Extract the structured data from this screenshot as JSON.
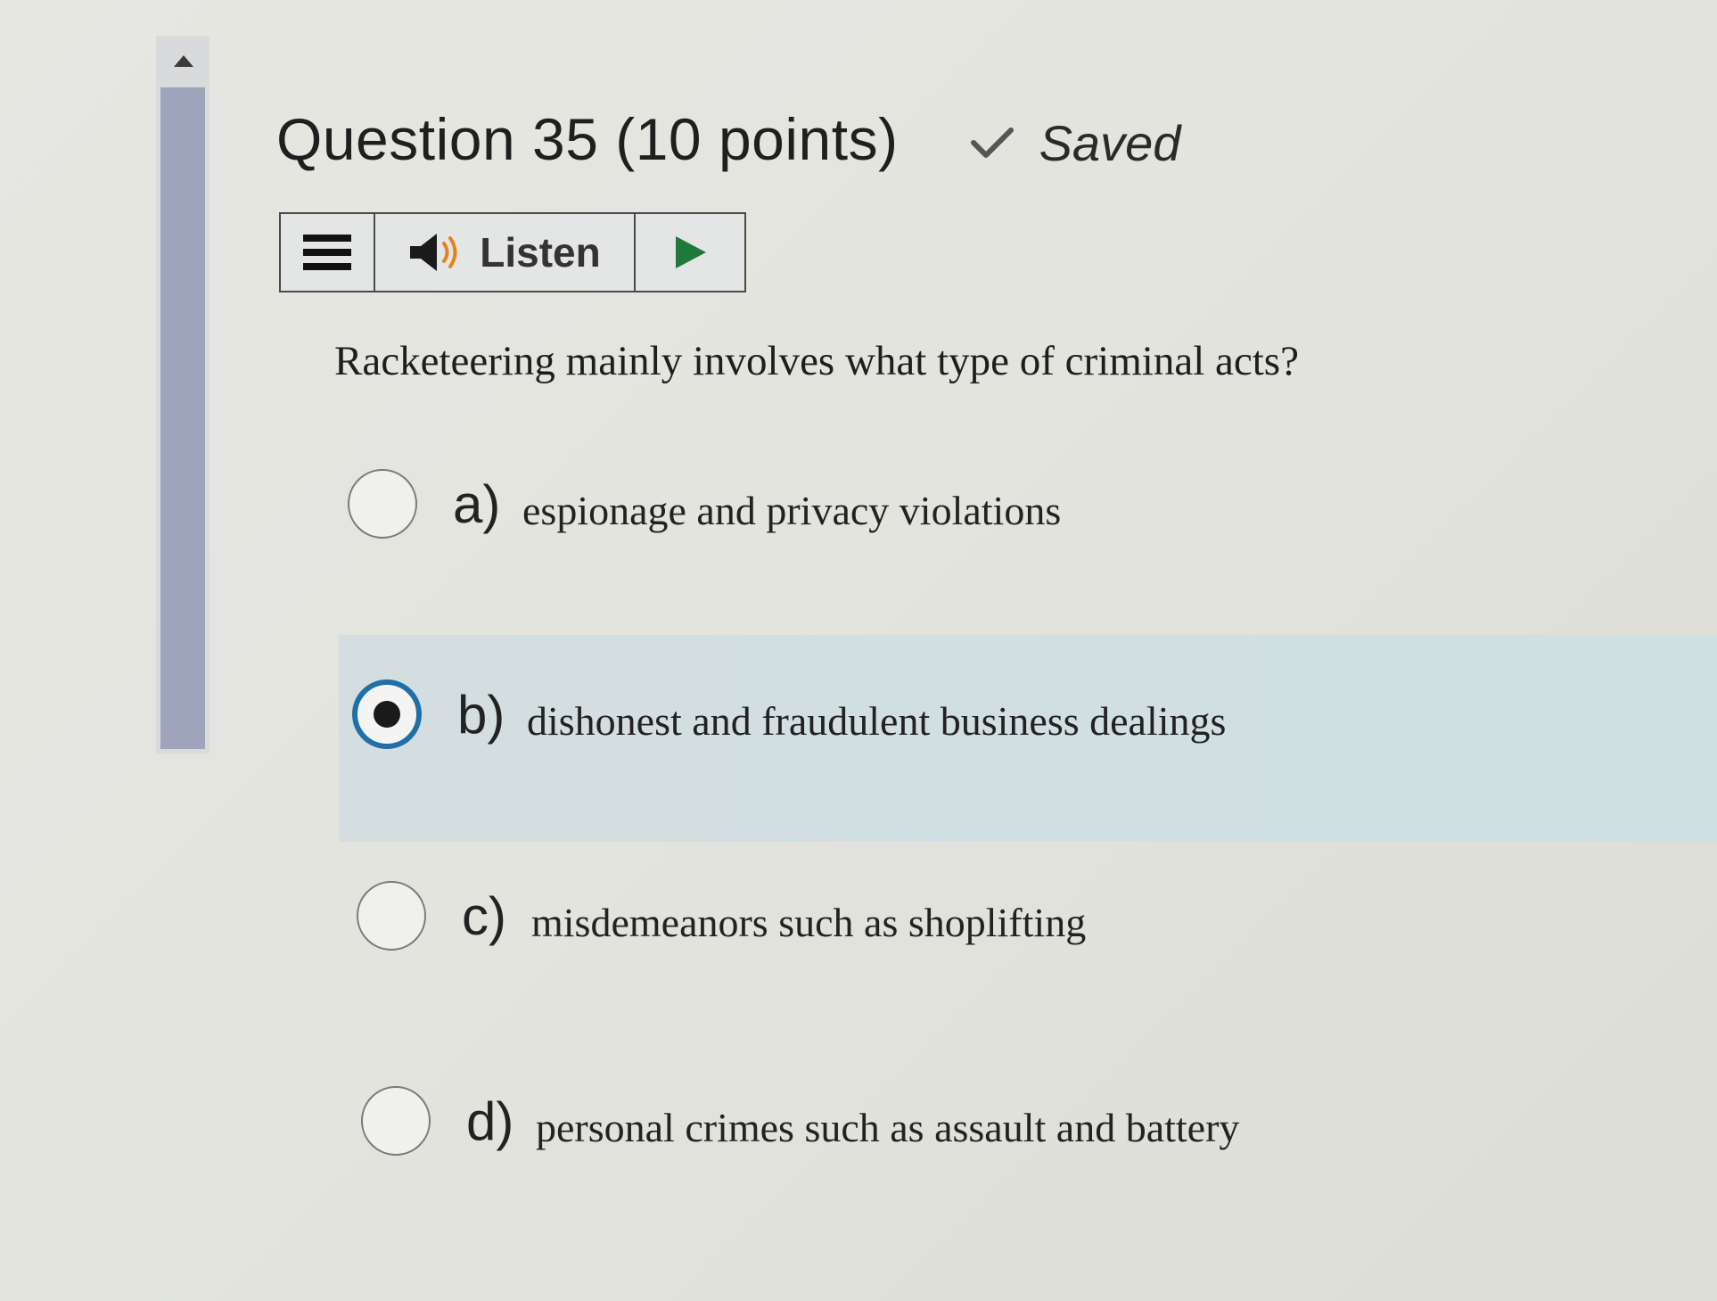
{
  "question": {
    "title": "Question 35 (10 points)",
    "status": "Saved",
    "prompt": "Racketeering mainly involves what type of criminal acts?"
  },
  "toolbar": {
    "listen_label": "Listen",
    "menu_icon": "menu-icon",
    "speaker_icon": "speaker-icon",
    "play_icon": "play-icon"
  },
  "options": [
    {
      "letter": "a)",
      "text": "espionage and privacy violations",
      "selected": false
    },
    {
      "letter": "b)",
      "text": "dishonest and fraudulent business dealings",
      "selected": true
    },
    {
      "letter": "c)",
      "text": "misdemeanors such as shoplifting",
      "selected": false
    },
    {
      "letter": "d)",
      "text": "personal crimes such as assault and battery",
      "selected": false
    }
  ],
  "colors": {
    "radio_selected": "#1f6fa8",
    "selected_background": "#d2dfe1",
    "scrollbar_thumb": "#9ea4b9",
    "play_icon": "#1f7a3a"
  }
}
